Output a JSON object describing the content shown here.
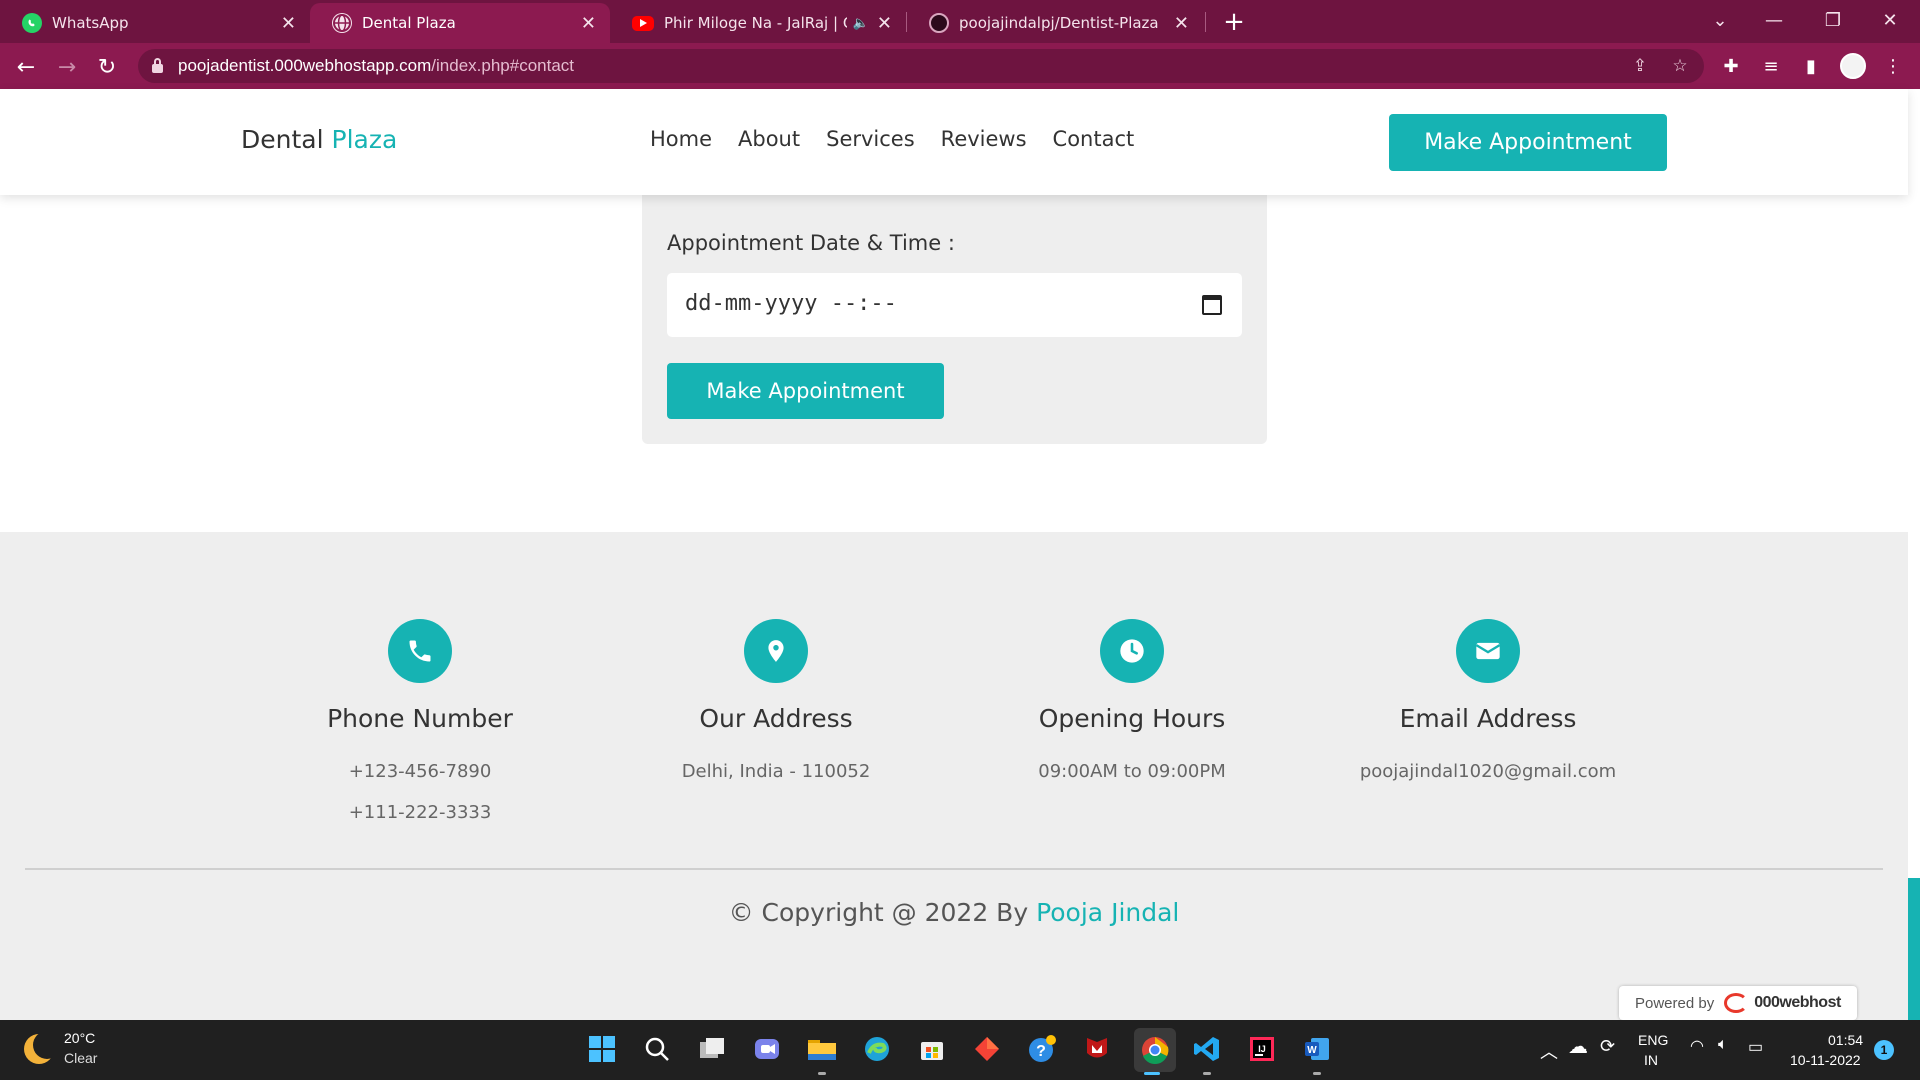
{
  "browser": {
    "tabs": [
      {
        "title": "WhatsApp",
        "favicon": "whatsapp-icon"
      },
      {
        "title": "Dental Plaza",
        "favicon": "globe-icon",
        "active": true
      },
      {
        "title": "Phir Miloge Na - JalRaj | Offic",
        "favicon": "youtube-icon",
        "audio": true
      },
      {
        "title": "poojajindalpj/Dentist-Plaza",
        "favicon": "github-icon"
      }
    ],
    "url_host": "poojadentist.000webhostapp.com",
    "url_path": "/index.php#contact"
  },
  "header": {
    "logo_part1": "Dental",
    "logo_part2": "Plaza",
    "nav": [
      "Home",
      "About",
      "Services",
      "Reviews",
      "Contact"
    ],
    "cta": "Make Appointment"
  },
  "form": {
    "datetime_label": "Appointment Date & Time :",
    "datetime_placeholder": "dd-mm-yyyy --:--",
    "submit": "Make Appointment"
  },
  "footer": {
    "info": [
      {
        "icon": "phone-icon",
        "title": "Phone Number",
        "lines": [
          "+123-456-7890",
          "+111-222-3333"
        ]
      },
      {
        "icon": "map-pin-icon",
        "title": "Our Address",
        "lines": [
          "Delhi, India - 110052"
        ]
      },
      {
        "icon": "clock-icon",
        "title": "Opening Hours",
        "lines": [
          "09:00AM to 09:00PM"
        ]
      },
      {
        "icon": "envelope-icon",
        "title": "Email Address",
        "lines": [
          "poojajindal1020@gmail.com"
        ]
      }
    ],
    "copyright_prefix": "© Copyright @ 2022 By",
    "copyright_author": "Pooja Jindal",
    "powered_label": "Powered by",
    "powered_brand": "000webhost"
  },
  "taskbar": {
    "temperature": "20°C",
    "condition": "Clear",
    "lang_top": "ENG",
    "lang_bottom": "IN",
    "time": "01:54",
    "date": "10-11-2022",
    "notification_count": "1"
  },
  "colors": {
    "accent": "#16b3b3",
    "browser_frame": "#6e1440",
    "browser_toolbar": "#8c1a50"
  }
}
